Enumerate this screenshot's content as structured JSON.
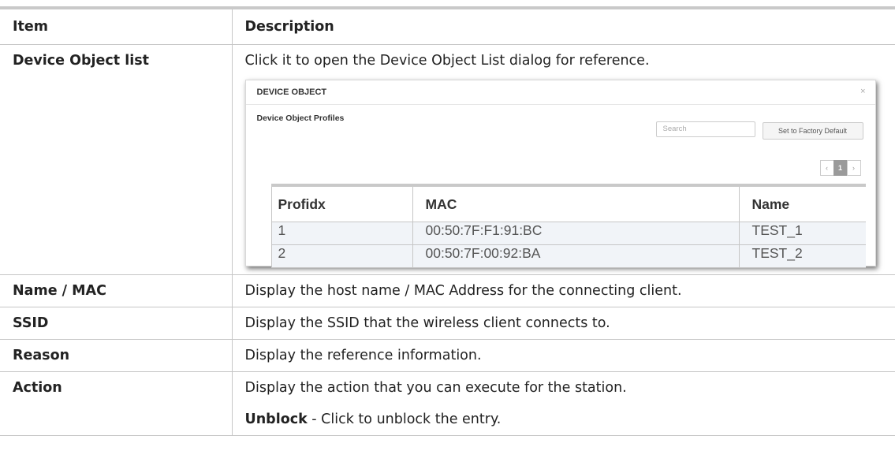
{
  "headers": {
    "item": "Item",
    "description": "Description"
  },
  "rows": [
    {
      "item": "Device Object list",
      "description": "Click it to open the Device Object List dialog for reference."
    },
    {
      "item": "Name / MAC",
      "description": "Display the host name / MAC Address for the connecting client."
    },
    {
      "item": "SSID",
      "description": "Display the SSID that the wireless client connects to."
    },
    {
      "item": "Reason",
      "description": "Display the reference information."
    },
    {
      "item": "Action",
      "description": "Display the action that you can execute for the station.",
      "extra_bold": "Unblock",
      "extra_text": " - Click to unblock the entry."
    }
  ],
  "dialog": {
    "title": "DEVICE OBJECT",
    "close": "×",
    "section_title": "Device Object Profiles",
    "search_placeholder": "Search",
    "factory_button": "Set to Factory Default",
    "pager": {
      "prev": "‹",
      "page": "1",
      "next": "›"
    },
    "columns": [
      "Profidx",
      "MAC",
      "Name"
    ],
    "entries": [
      {
        "idx": "1",
        "mac": "00:50:7F:F1:91:BC",
        "name": "TEST_1"
      },
      {
        "idx": "2",
        "mac": "00:50:7F:00:92:BA",
        "name": "TEST_2"
      }
    ]
  }
}
